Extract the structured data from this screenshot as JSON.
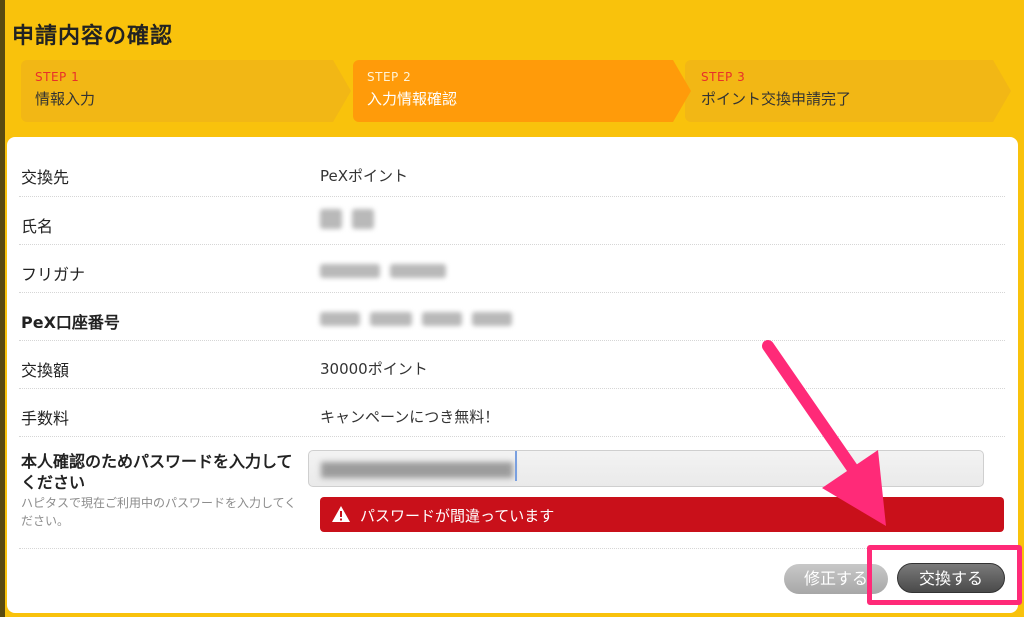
{
  "page": {
    "title": "申請内容の確認"
  },
  "steps": [
    {
      "num": "STEP 1",
      "name": "情報入力",
      "state": "done"
    },
    {
      "num": "STEP 2",
      "name": "入力情報確認",
      "state": "active"
    },
    {
      "num": "STEP 3",
      "name": "ポイント交換申請完了",
      "state": "pending"
    }
  ],
  "form": {
    "rows": [
      {
        "label": "交換先",
        "value": "PeXポイント"
      },
      {
        "label": "氏名",
        "value": ""
      },
      {
        "label": "フリガナ",
        "value": ""
      },
      {
        "label": "PeX口座番号",
        "value": ""
      },
      {
        "label": "交換額",
        "value": "30000ポイント"
      },
      {
        "label": "手数料",
        "value": "キャンペーンにつき無料！"
      }
    ],
    "password": {
      "label": "本人確認のためパスワードを入力してください",
      "help": "ハピタスで現在ご利用中のパスワードを入力してください。",
      "error": "パスワードが間違っています"
    }
  },
  "buttons": {
    "edit": "修正する",
    "exchange": "交換する"
  },
  "colors": {
    "background": "#f9c20c",
    "active_step": "#ff9b0a",
    "error": "#c9101a",
    "annotation": "#ff2a78"
  }
}
